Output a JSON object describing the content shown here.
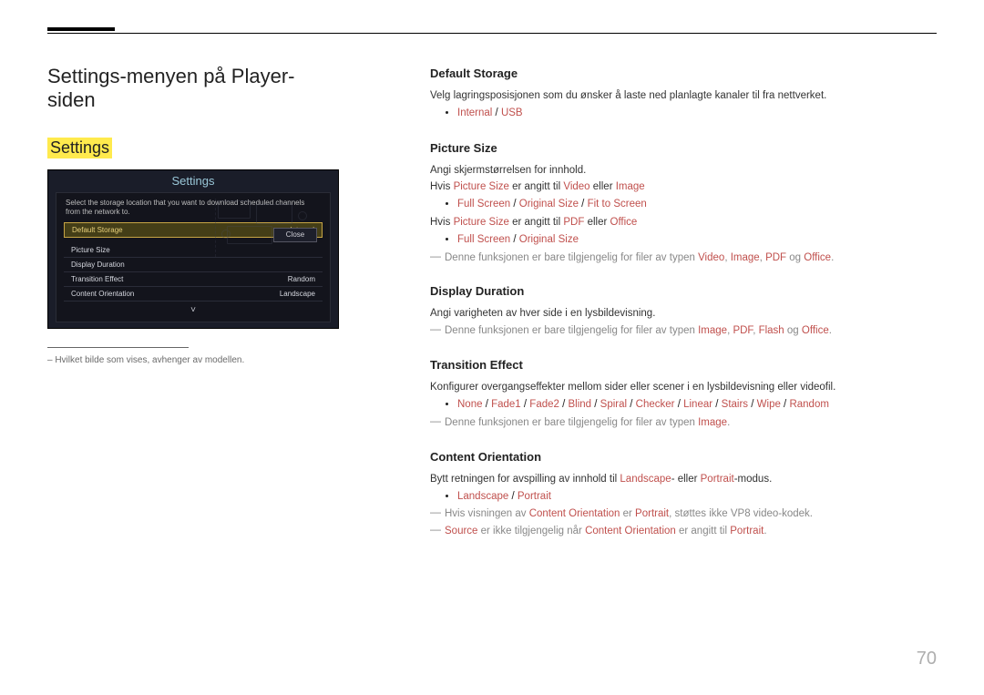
{
  "pageTitle": "Settings-menyen på Player-siden",
  "settingsHighlighted": "Settings",
  "panel": {
    "title": "Settings",
    "desc": "Select the storage location that you want to download scheduled channels from the network to.",
    "close": "Close",
    "rows": [
      {
        "label": "Default Storage",
        "value": "Internal"
      },
      {
        "label": "Picture Size",
        "value": ""
      },
      {
        "label": "Display Duration",
        "value": ""
      },
      {
        "label": "Transition Effect",
        "value": "Random"
      },
      {
        "label": "Content Orientation",
        "value": "Landscape"
      }
    ],
    "chev": "˅"
  },
  "footnote": "– Hvilket bilde som vises, avhenger av modellen.",
  "sections": {
    "defaultStorage": {
      "h": "Default Storage",
      "body": "Velg lagringsposisjonen som du ønsker å laste ned planlagte kanaler til fra nettverket.",
      "bullet": {
        "parts": [
          "Internal",
          " / ",
          "USB"
        ]
      }
    },
    "pictureSize": {
      "h": "Picture Size",
      "body": "Angi skjermstørrelsen for innhold.",
      "line2": {
        "t1": "Hvis ",
        "r1": "Picture Size",
        "t2": " er angitt til ",
        "r2": "Video",
        "t3": " eller ",
        "r3": "Image"
      },
      "bullet1": {
        "p0": "Full Screen",
        "sep1": " / ",
        "p1": "Original Size",
        "sep2": " / ",
        "p2": "Fit to Screen"
      },
      "line3": {
        "t1": "Hvis ",
        "r1": "Picture Size",
        "t2": " er angitt til ",
        "r2": "PDF",
        "t3": " eller ",
        "r3": "Office"
      },
      "bullet2": {
        "p0": "Full Screen",
        "sep": " / ",
        "p1": "Original Size"
      },
      "note": {
        "t1": "Denne funksjonen er bare tilgjengelig for filer av typen ",
        "r1": "Video",
        "c1": ", ",
        "r2": "Image",
        "c2": ", ",
        "r3": "PDF",
        "t2": " og ",
        "r4": "Office",
        "t3": "."
      }
    },
    "displayDuration": {
      "h": "Display Duration",
      "body": "Angi varigheten av hver side i en lysbildevisning.",
      "note": {
        "t1": "Denne funksjonen er bare tilgjengelig for filer av typen ",
        "r1": "Image",
        "c1": ", ",
        "r2": "PDF",
        "c2": ", ",
        "r3": "Flash",
        "t2": " og ",
        "r4": "Office",
        "t3": "."
      }
    },
    "transitionEffect": {
      "h": "Transition Effect",
      "body": "Konfigurer overgangseffekter mellom sider eller scener i en lysbildevisning eller videofil.",
      "bullet": {
        "p": [
          "None",
          "Fade1",
          "Fade2",
          "Blind",
          "Spiral",
          "Checker",
          "Linear",
          "Stairs",
          "Wipe",
          "Random"
        ],
        "sep": " / "
      },
      "note": {
        "t1": "Denne funksjonen er bare tilgjengelig for filer av typen ",
        "r1": "Image",
        "t2": "."
      }
    },
    "contentOrientation": {
      "h": "Content Orientation",
      "body": {
        "t1": "Bytt retningen for avspilling av innhold til ",
        "r1": "Landscape",
        "t2": "- eller ",
        "r2": "Portrait",
        "t3": "-modus."
      },
      "bullet": {
        "p0": "Landscape",
        "sep": " / ",
        "p1": "Portrait"
      },
      "note1": {
        "t1": "Hvis visningen av ",
        "r1": "Content Orientation",
        "t2": " er ",
        "r2": "Portrait",
        "t3": ", støttes ikke VP8 video-kodek."
      },
      "note2": {
        "r1": "Source",
        "t1": " er ikke tilgjengelig når ",
        "r2": "Content Orientation",
        "t2": " er angitt til ",
        "r3": "Portrait",
        "t3": "."
      }
    }
  },
  "pageNumber": "70"
}
